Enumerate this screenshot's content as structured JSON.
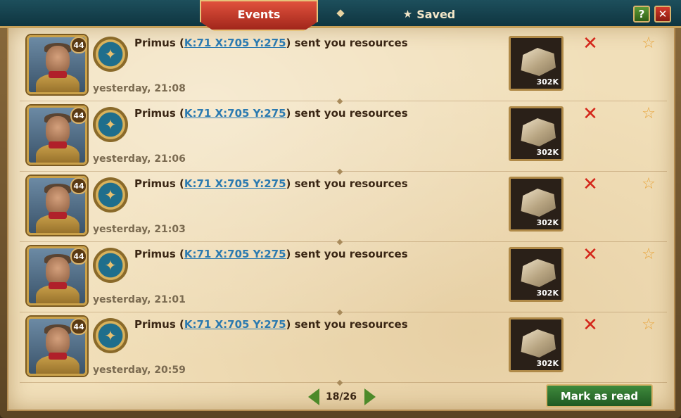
{
  "header": {
    "tab_events": "Events",
    "tab_saved": "Saved",
    "help_label": "?",
    "close_label": "✕"
  },
  "rows": [
    {
      "level": "44",
      "sender": "Primus",
      "coords": "K:71 X:705 Y:275",
      "action": "sent you resources",
      "time": "yesterday, 21:08",
      "resource_amount": "302K"
    },
    {
      "level": "44",
      "sender": "Primus",
      "coords": "K:71 X:705 Y:275",
      "action": "sent you resources",
      "time": "yesterday, 21:06",
      "resource_amount": "302K"
    },
    {
      "level": "44",
      "sender": "Primus",
      "coords": "K:71 X:705 Y:275",
      "action": "sent you resources",
      "time": "yesterday, 21:03",
      "resource_amount": "302K"
    },
    {
      "level": "44",
      "sender": "Primus",
      "coords": "K:71 X:705 Y:275",
      "action": "sent you resources",
      "time": "yesterday, 21:01",
      "resource_amount": "302K"
    },
    {
      "level": "44",
      "sender": "Primus",
      "coords": "K:71 X:705 Y:275",
      "action": "sent you resources",
      "time": "yesterday, 20:59",
      "resource_amount": "302K"
    }
  ],
  "footer": {
    "page": "18/26",
    "mark_read_label": "Mark as read"
  },
  "icons": {
    "delete": "close-x-icon",
    "favorite": "star-outline-icon",
    "resource": "stone-icon",
    "emblem": "eagle-emblem-icon"
  },
  "colors": {
    "accent_red": "#d4261a",
    "link_blue": "#2b7ab0",
    "button_green": "#3f8a3c",
    "header_teal": "#1d4f5c"
  }
}
